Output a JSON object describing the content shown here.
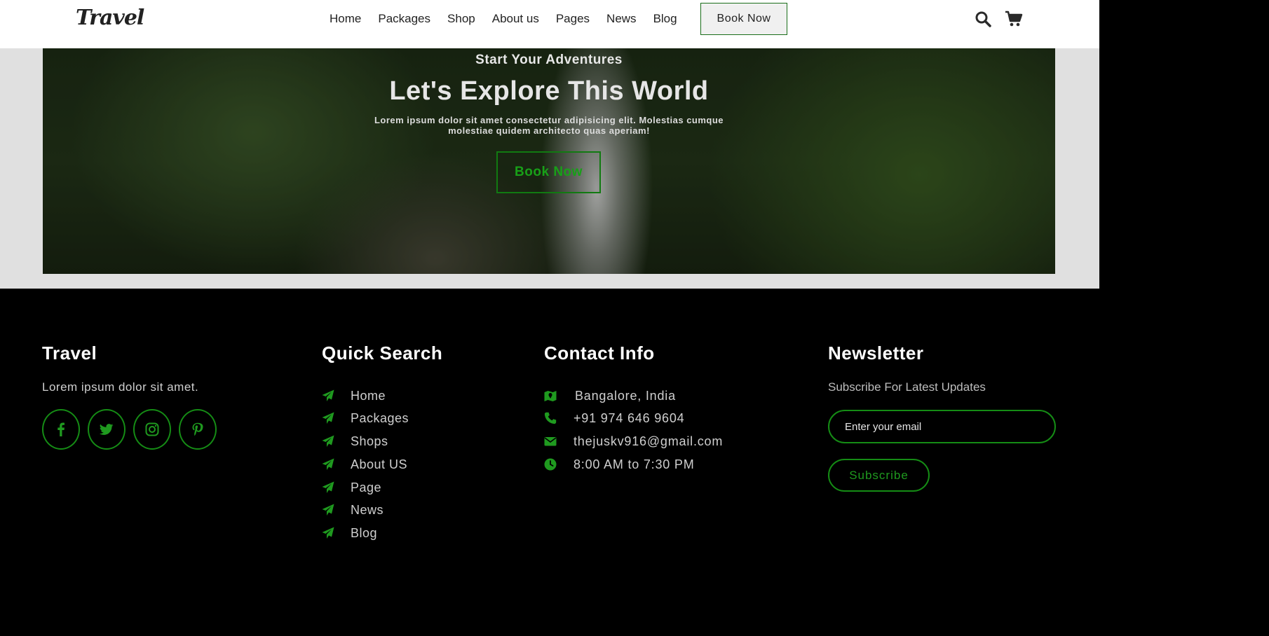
{
  "header": {
    "logo": "Travel",
    "nav": [
      "Home",
      "Packages",
      "Shop",
      "About us",
      "Pages",
      "News",
      "Blog"
    ],
    "book_label": "Book Now",
    "icons": [
      "search-icon",
      "cart-icon"
    ]
  },
  "hero": {
    "subtitle": "Start Your Adventures",
    "title": "Let's Explore This World",
    "text": "Lorem ipsum dolor sit amet consectetur adipisicing elit. Molestias cumque molestiae quidem architecto quas aperiam!",
    "button": "Book Now"
  },
  "footer": {
    "about": {
      "title": "Travel",
      "text": "Lorem ipsum dolor sit amet.",
      "socials": [
        "facebook-icon",
        "twitter-icon",
        "instagram-icon",
        "pinterest-icon"
      ]
    },
    "quick": {
      "title": "Quick Search",
      "items": [
        "Home",
        "Packages",
        "Shops",
        "About US",
        "Page",
        "News",
        "Blog"
      ]
    },
    "contact": {
      "title": "Contact Info",
      "items": [
        {
          "icon": "map-icon",
          "text": "Bangalore, India"
        },
        {
          "icon": "phone-icon",
          "text": "+91 974 646 9604"
        },
        {
          "icon": "envelope-icon",
          "text": "thejuskv916@gmail.com"
        },
        {
          "icon": "clock-icon",
          "text": "8:00 AM to 7:30 PM"
        }
      ]
    },
    "newsletter": {
      "title": "Newsletter",
      "subtitle": "Subscribe For Latest Updates",
      "placeholder": "Enter your email",
      "button": "Subscribe"
    }
  },
  "colors": {
    "accent": "#158c15",
    "footer_bg": "#000000",
    "hero_wrap_bg": "#e0e0e0"
  }
}
